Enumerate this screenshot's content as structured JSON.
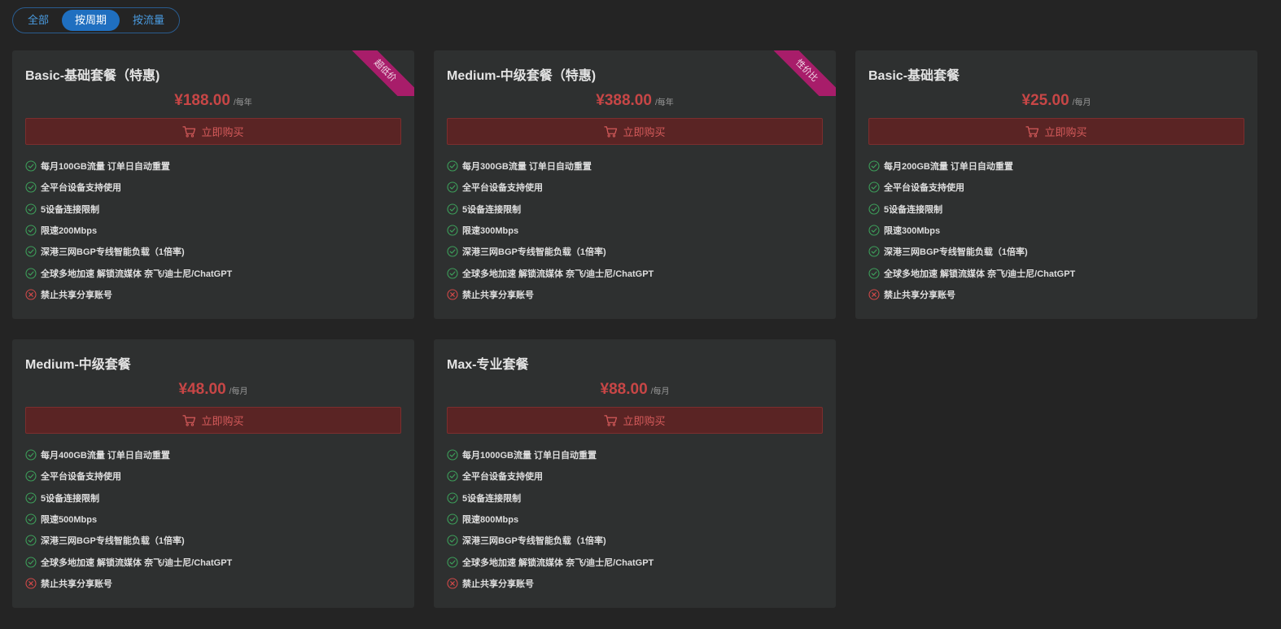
{
  "tabs": [
    {
      "label": "全部",
      "active": false
    },
    {
      "label": "按周期",
      "active": true
    },
    {
      "label": "按流量",
      "active": false
    }
  ],
  "buy_label": "立即购买",
  "colors": {
    "background": "#242424",
    "card": "#2e3030",
    "price": "#c74646",
    "button_bg": "#5a2424",
    "tab_active": "#1f6fc0",
    "ribbon": "#a81d6a",
    "check": "#3d9e5a",
    "cross": "#d04848"
  },
  "plans": [
    {
      "title": "Basic-基础套餐（特惠)",
      "price": "¥188.00",
      "period": "/每年",
      "ribbon": "超低价",
      "features": [
        {
          "text": "每月100GB流量 订单日自动重置",
          "icon": "check-icon"
        },
        {
          "text": "全平台设备支持使用",
          "icon": "check-icon"
        },
        {
          "text": "5设备连接限制",
          "icon": "check-icon"
        },
        {
          "text": "限速200Mbps",
          "icon": "check-icon"
        },
        {
          "text": "深港三网BGP专线智能负载（1倍率)",
          "icon": "check-icon"
        },
        {
          "text": "全球多地加速 解锁流媒体 奈飞/迪士尼/ChatGPT",
          "icon": "check-icon"
        },
        {
          "text": "禁止共享分享账号",
          "icon": "cross-icon"
        }
      ]
    },
    {
      "title": "Medium-中级套餐（特惠)",
      "price": "¥388.00",
      "period": "/每年",
      "ribbon": "性价比",
      "features": [
        {
          "text": "每月300GB流量 订单日自动重置",
          "icon": "check-icon"
        },
        {
          "text": "全平台设备支持使用",
          "icon": "check-icon"
        },
        {
          "text": "5设备连接限制",
          "icon": "check-icon"
        },
        {
          "text": "限速300Mbps",
          "icon": "check-icon"
        },
        {
          "text": "深港三网BGP专线智能负载（1倍率)",
          "icon": "check-icon"
        },
        {
          "text": "全球多地加速 解锁流媒体 奈飞/迪士尼/ChatGPT",
          "icon": "check-icon"
        },
        {
          "text": "禁止共享分享账号",
          "icon": "cross-icon"
        }
      ]
    },
    {
      "title": "Basic-基础套餐",
      "price": "¥25.00",
      "period": "/每月",
      "ribbon": "",
      "features": [
        {
          "text": "每月200GB流量 订单日自动重置",
          "icon": "check-icon"
        },
        {
          "text": "全平台设备支持使用",
          "icon": "check-icon"
        },
        {
          "text": "5设备连接限制",
          "icon": "check-icon"
        },
        {
          "text": "限速300Mbps",
          "icon": "check-icon"
        },
        {
          "text": "深港三网BGP专线智能负载（1倍率)",
          "icon": "check-icon"
        },
        {
          "text": "全球多地加速 解锁流媒体 奈飞/迪士尼/ChatGPT",
          "icon": "check-icon"
        },
        {
          "text": "禁止共享分享账号",
          "icon": "cross-icon"
        }
      ]
    },
    {
      "title": "Medium-中级套餐",
      "price": "¥48.00",
      "period": "/每月",
      "ribbon": "",
      "features": [
        {
          "text": "每月400GB流量 订单日自动重置",
          "icon": "check-icon"
        },
        {
          "text": "全平台设备支持使用",
          "icon": "check-icon"
        },
        {
          "text": "5设备连接限制",
          "icon": "check-icon"
        },
        {
          "text": "限速500Mbps",
          "icon": "check-icon"
        },
        {
          "text": "深港三网BGP专线智能负载（1倍率)",
          "icon": "check-icon"
        },
        {
          "text": "全球多地加速 解锁流媒体 奈飞/迪士尼/ChatGPT",
          "icon": "check-icon"
        },
        {
          "text": "禁止共享分享账号",
          "icon": "cross-icon"
        }
      ]
    },
    {
      "title": "Max-专业套餐",
      "price": "¥88.00",
      "period": "/每月",
      "ribbon": "",
      "features": [
        {
          "text": "每月1000GB流量 订单日自动重置",
          "icon": "check-icon"
        },
        {
          "text": "全平台设备支持使用",
          "icon": "check-icon"
        },
        {
          "text": "5设备连接限制",
          "icon": "check-icon"
        },
        {
          "text": "限速800Mbps",
          "icon": "check-icon"
        },
        {
          "text": "深港三网BGP专线智能负载（1倍率)",
          "icon": "check-icon"
        },
        {
          "text": "全球多地加速 解锁流媒体 奈飞/迪士尼/ChatGPT",
          "icon": "check-icon"
        },
        {
          "text": "禁止共享分享账号",
          "icon": "cross-icon"
        }
      ]
    }
  ]
}
